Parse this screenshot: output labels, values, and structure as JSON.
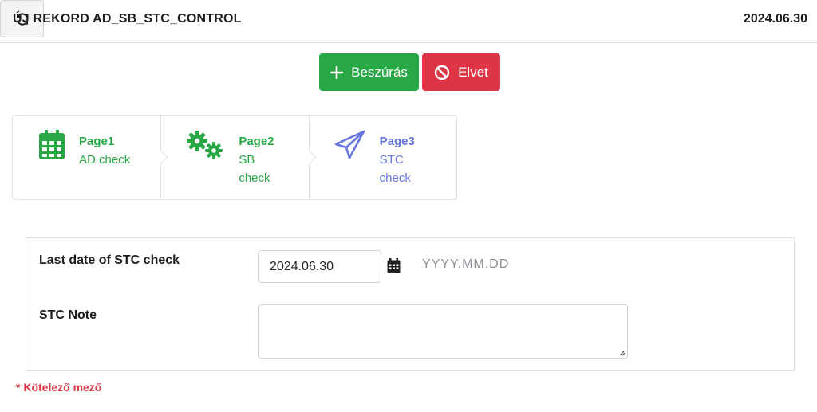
{
  "header": {
    "title": "ÚJ REKORD AD_SB_STC_CONTROL",
    "date": "2024.06.30"
  },
  "toolbar": {
    "insert_label": "Beszúrás",
    "reject_label": "Elvet",
    "insert_icon": "plus-icon",
    "reject_icon": "ban-icon",
    "refresh_icon": "refresh-icon"
  },
  "steps": [
    {
      "title": "Page1",
      "subtitle": "AD check",
      "icon": "calendar-icon",
      "color": "#28a745"
    },
    {
      "title": "Page2",
      "subtitle_line1": "SB",
      "subtitle_line2": "check",
      "icon": "gears-icon",
      "color": "#28a745"
    },
    {
      "title": "Page3",
      "subtitle_line1": "STC",
      "subtitle_line2": "check",
      "icon": "paper-plane-icon",
      "color": "#6675e0"
    }
  ],
  "form": {
    "last_date_label": "Last date of STC check",
    "last_date_value": "2024.06.30",
    "date_format_hint": "YYYY.MM.DD",
    "note_label": "STC Note",
    "note_value": ""
  },
  "footer": {
    "required_text": "* Kötelező mező"
  },
  "colors": {
    "success": "#28a745",
    "danger": "#dc3545",
    "active_step": "#6675e0"
  }
}
